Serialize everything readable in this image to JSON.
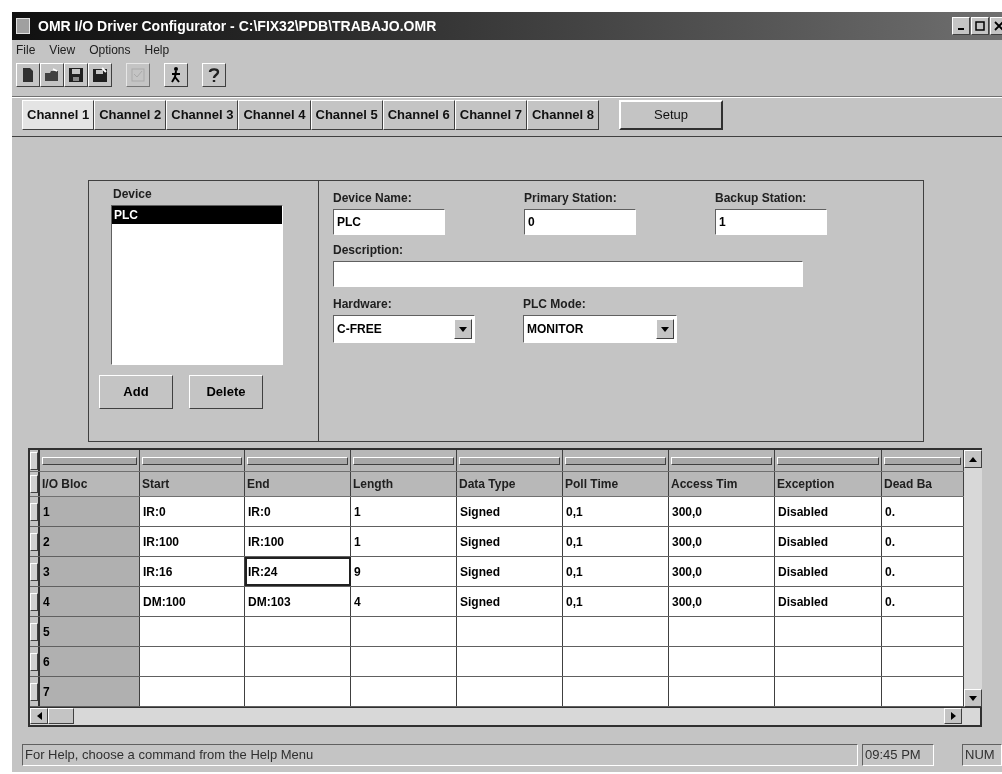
{
  "window": {
    "title": "OMR I/O Driver Configurator - C:\\FIX32\\PDB\\TRABAJO.OMR"
  },
  "menu": [
    "File",
    "View",
    "Options",
    "Help"
  ],
  "toolbar": [
    {
      "kind": "new",
      "disabled": false
    },
    {
      "kind": "open",
      "disabled": false
    },
    {
      "kind": "save",
      "disabled": false
    },
    {
      "kind": "saveall",
      "disabled": false
    },
    {
      "kind": "gap"
    },
    {
      "kind": "check",
      "disabled": true
    },
    {
      "kind": "gap"
    },
    {
      "kind": "run",
      "disabled": false
    },
    {
      "kind": "gap"
    },
    {
      "kind": "help",
      "disabled": false
    }
  ],
  "tabs": [
    {
      "label": "Channel 1",
      "selected": true
    },
    {
      "label": "Channel 2",
      "selected": false
    },
    {
      "label": "Channel 3",
      "selected": false
    },
    {
      "label": "Channel 4",
      "selected": false
    },
    {
      "label": "Channel 5",
      "selected": false
    },
    {
      "label": "Channel 6",
      "selected": false
    },
    {
      "label": "Channel 7",
      "selected": false
    },
    {
      "label": "Channel 8",
      "selected": false
    }
  ],
  "setup_button": "Setup",
  "device": {
    "label": "Device",
    "items": [
      {
        "label": "PLC",
        "selected": true
      }
    ],
    "buttons": [
      "Add",
      "Delete"
    ]
  },
  "fields": {
    "device_name": {
      "label": "Device Name:",
      "value": "PLC"
    },
    "primary_station": {
      "label": "Primary Station:",
      "value": "0"
    },
    "backup_station": {
      "label": "Backup Station:",
      "value": "1"
    },
    "description": {
      "label": "Description:"
    },
    "hardware": {
      "label": "Hardware:",
      "value": "C-FREE"
    },
    "plc_mode": {
      "label": "PLC Mode:",
      "value": "MONITOR"
    }
  },
  "table": {
    "columns": [
      "I/O Bloc",
      "Start",
      "End",
      "Length",
      "Data Type",
      "Poll Time",
      "Access Tim",
      "Exception",
      "Dead Ba"
    ],
    "rows": [
      {
        "block": "1",
        "cells": [
          {
            "text": "IR:0",
            "selected": false
          },
          {
            "text": "IR:0",
            "selected": false
          },
          {
            "text": "1",
            "selected": false
          },
          {
            "text": "Signed",
            "selected": false
          },
          {
            "text": "0,1",
            "selected": false
          },
          {
            "text": "300,0",
            "selected": false
          },
          {
            "text": "Disabled",
            "selected": false
          },
          {
            "text": "0.",
            "selected": false
          }
        ]
      },
      {
        "block": "2",
        "cells": [
          {
            "text": "IR:100",
            "selected": false
          },
          {
            "text": "IR:100",
            "selected": false
          },
          {
            "text": "1",
            "selected": false
          },
          {
            "text": "Signed",
            "selected": false
          },
          {
            "text": "0,1",
            "selected": false
          },
          {
            "text": "300,0",
            "selected": false
          },
          {
            "text": "Disabled",
            "selected": false
          },
          {
            "text": "0.",
            "selected": false
          }
        ]
      },
      {
        "block": "3",
        "cells": [
          {
            "text": "IR:16",
            "selected": false
          },
          {
            "text": "IR:24",
            "selected": true
          },
          {
            "text": "9",
            "selected": false
          },
          {
            "text": "Signed",
            "selected": false
          },
          {
            "text": "0,1",
            "selected": false
          },
          {
            "text": "300,0",
            "selected": false
          },
          {
            "text": "Disabled",
            "selected": false
          },
          {
            "text": "0.",
            "selected": false
          }
        ]
      },
      {
        "block": "4",
        "cells": [
          {
            "text": "DM:100",
            "selected": false
          },
          {
            "text": "DM:103",
            "selected": false
          },
          {
            "text": "4",
            "selected": false
          },
          {
            "text": "Signed",
            "selected": false
          },
          {
            "text": "0,1",
            "selected": false
          },
          {
            "text": "300,0",
            "selected": false
          },
          {
            "text": "Disabled",
            "selected": false
          },
          {
            "text": "0.",
            "selected": false
          }
        ]
      },
      {
        "block": "5"
      },
      {
        "block": "6"
      },
      {
        "block": "7"
      }
    ]
  },
  "status_bar": {
    "message": "For Help, choose a command from the Help Menu",
    "time": "09:45 PM",
    "num": "NUM"
  }
}
